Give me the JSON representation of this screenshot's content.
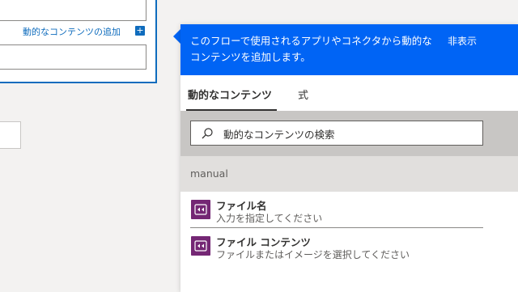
{
  "left_card": {
    "dynamic_link_label": "動的なコンテンツの追加",
    "plus_glyph": "+"
  },
  "panel": {
    "header_text": "このフローで使用されるアプリやコネクタから動的なコンテンツを追加します。",
    "hide_label": "非表示",
    "tabs": [
      {
        "label": "動的なコンテンツ",
        "active": true
      },
      {
        "label": "式",
        "active": false
      }
    ],
    "search": {
      "placeholder": "動的なコンテンツの検索",
      "icon": "search-icon"
    },
    "section_title": "manual",
    "items": [
      {
        "title": "ファイル名",
        "description": "入力を指定してください",
        "icon": "power-automate-trigger-icon"
      },
      {
        "title": "ファイル コンテンツ",
        "description": "ファイルまたはイメージを選択してください",
        "icon": "power-automate-trigger-icon"
      }
    ],
    "colors": {
      "header_bg": "#0064f5",
      "item_icon_bg": "#742774",
      "link": "#0f6cbd"
    }
  }
}
